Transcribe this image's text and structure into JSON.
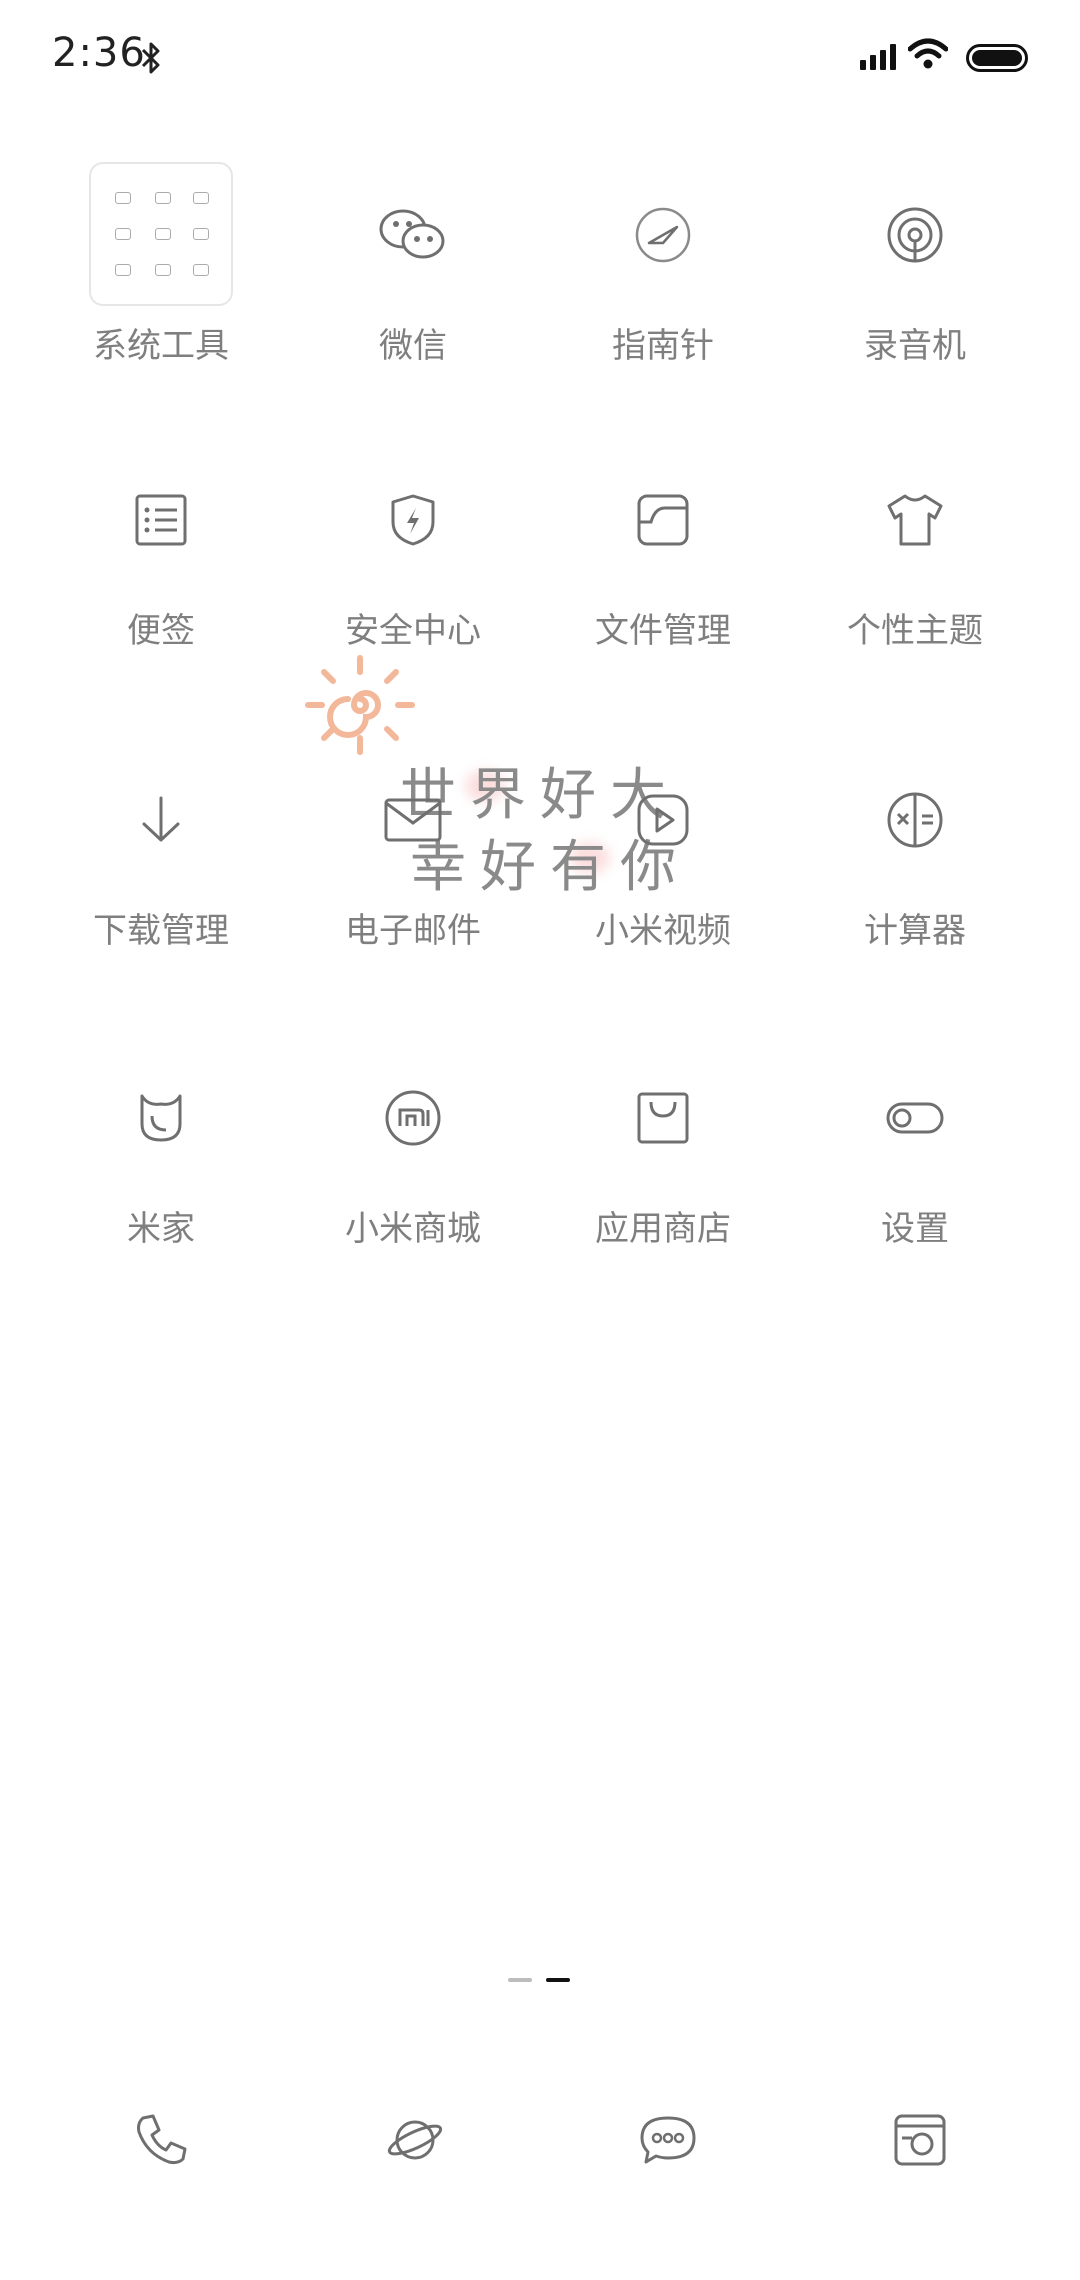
{
  "status_bar": {
    "time": "2:36",
    "icons": [
      "bluetooth-icon",
      "signal-icon",
      "wifi-icon",
      "battery-icon"
    ]
  },
  "home": {
    "apps": [
      {
        "label": "系统工具",
        "icon": "folder-icon"
      },
      {
        "label": "微信",
        "icon": "wechat-icon"
      },
      {
        "label": "指南针",
        "icon": "compass-icon"
      },
      {
        "label": "录音机",
        "icon": "recorder-icon"
      },
      {
        "label": "便签",
        "icon": "notes-icon"
      },
      {
        "label": "安全中心",
        "icon": "security-shield-icon"
      },
      {
        "label": "文件管理",
        "icon": "file-manager-icon"
      },
      {
        "label": "个性主题",
        "icon": "theme-shirt-icon"
      },
      {
        "label": "下载管理",
        "icon": "download-arrow-icon"
      },
      {
        "label": "电子邮件",
        "icon": "mail-icon"
      },
      {
        "label": "小米视频",
        "icon": "video-play-icon"
      },
      {
        "label": "计算器",
        "icon": "calculator-icon"
      },
      {
        "label": "米家",
        "icon": "mijia-icon"
      },
      {
        "label": "小米商城",
        "icon": "mi-store-icon"
      },
      {
        "label": "应用商店",
        "icon": "app-store-bag-icon"
      },
      {
        "label": "设置",
        "icon": "settings-toggle-icon"
      }
    ],
    "wallpaper_text": [
      "世界好大",
      "幸好有你"
    ],
    "page_indicator": {
      "pages": 2,
      "current": 2
    }
  },
  "dock": {
    "items": [
      "phone-icon",
      "browser-planet-icon",
      "messages-icon",
      "camera-icon"
    ]
  },
  "colors": {
    "icon_stroke": "#6f6f6f",
    "label": "#7f7f7f",
    "active_dot": "#111111"
  }
}
